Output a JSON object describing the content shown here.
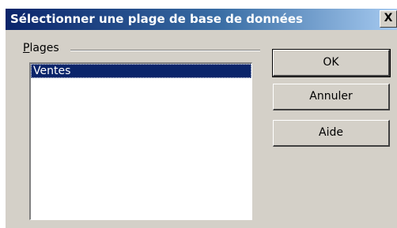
{
  "window": {
    "title": "Sélectionner une plage de base de données",
    "close_label": "X"
  },
  "group": {
    "label_accel": "P",
    "label_rest": "lages"
  },
  "list": {
    "items": [
      "Ventes"
    ],
    "selected_index": 0
  },
  "buttons": {
    "ok": "OK",
    "cancel": "Annuler",
    "help": "Aide"
  }
}
